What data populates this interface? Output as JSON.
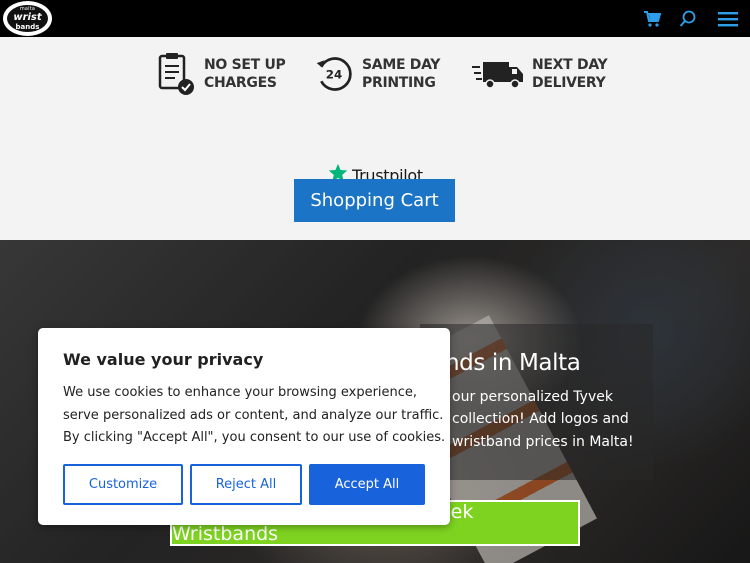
{
  "header": {
    "logo": {
      "line1": "malta",
      "line2": "wrist",
      "line3": "bands"
    },
    "icons": [
      "cart-icon",
      "search-icon",
      "menu-icon"
    ]
  },
  "features": [
    {
      "icon": "checklist-icon",
      "line1": "NO SET UP",
      "line2": "CHARGES"
    },
    {
      "icon": "24-hour-clock-icon",
      "line1": "SAME DAY",
      "line2": "PRINTING"
    },
    {
      "icon": "delivery-truck-icon",
      "line1": "NEXT DAY",
      "line2": "DELIVERY"
    }
  ],
  "trustpilot": {
    "label": "Trustpilot",
    "icon": "star-icon"
  },
  "shopping_cart_button": "Shopping Cart",
  "hero": {
    "title": "nds in Malta",
    "lines": [
      "our personalized Tyvek",
      "collection! Add logos and",
      "wristband prices in Malta!"
    ],
    "design_button": "Design your personalized Tyvek Wristbands"
  },
  "cookie": {
    "title": "We value your privacy",
    "lines": [
      "We use cookies to enhance your browsing experience,",
      "serve personalized ads or content, and analyze our traffic.",
      "By clicking \"Accept All\", you consent to our use of cookies."
    ],
    "customize": "Customize",
    "reject": "Reject All",
    "accept": "Accept All"
  },
  "colors": {
    "header_bg": "#000000",
    "accent_blue": "#1b74c5",
    "cookie_blue": "#1863dc",
    "design_green": "#7ed321",
    "trustpilot_green": "#00b67a",
    "header_icon_blue": "#2e9ee8"
  }
}
